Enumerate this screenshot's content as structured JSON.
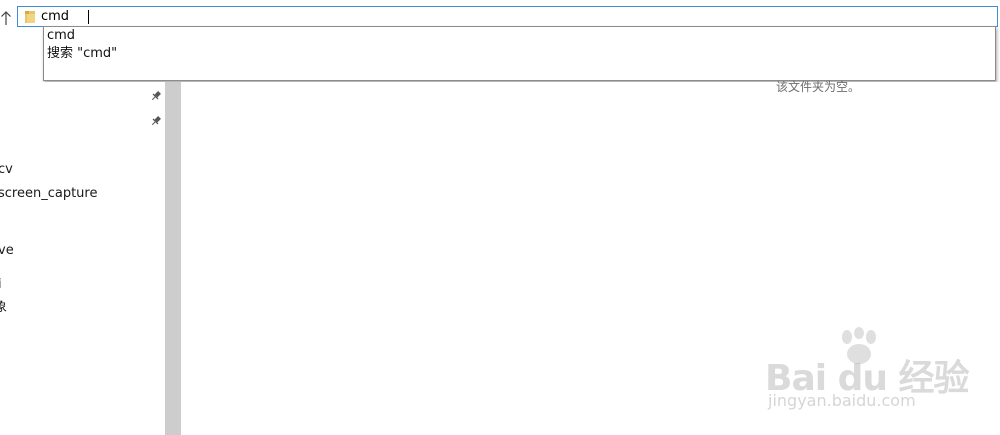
{
  "address_bar": {
    "value": "cmd",
    "folder_icon": "folder-icon",
    "up_icon": "up-arrow-icon"
  },
  "suggestions": [
    {
      "label": "cmd"
    },
    {
      "label": "搜索 \"cmd\""
    }
  ],
  "nav_pane": {
    "pin_icon": "pin-icon",
    "items": [
      {
        "label": "cv"
      },
      {
        "label": "screen_capture"
      },
      {
        "label": "ve"
      },
      {
        "label": "i"
      },
      {
        "label": "象"
      }
    ]
  },
  "content": {
    "empty_message": "该文件夹为空。"
  },
  "watermark": {
    "brand": "Bai du 经验",
    "url": "jingyan.baidu.com"
  },
  "colors": {
    "address_border": "#3c8fd6",
    "splitter": "#cdcdcd",
    "folder": "#e8c46a"
  }
}
